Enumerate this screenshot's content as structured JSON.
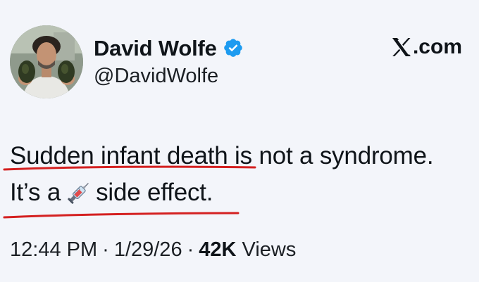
{
  "author": {
    "display_name": "David Wolfe",
    "handle": "@DavidWolfe",
    "verified": true
  },
  "brand": {
    "label": ".com"
  },
  "tweet": {
    "line1_part1": "Sudden infant death",
    "line1_part2": " is not a syndrome.",
    "line2_part1": "It’s a",
    "emoji": "syringe-icon",
    "line2_part2": "side effect."
  },
  "meta": {
    "time": "12:44 PM",
    "separator": "·",
    "date": "1/29/26",
    "views_count": "42K",
    "views_label": " Views"
  },
  "colors": {
    "background": "#f3f5fa",
    "verified_badge": "#1d9bf0",
    "annotation_underline": "#d42020"
  }
}
